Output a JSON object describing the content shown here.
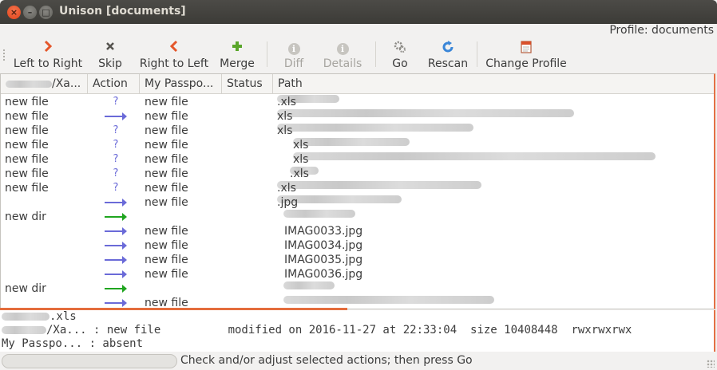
{
  "window": {
    "title": "Unison [documents]"
  },
  "profile_label": "Profile: documents",
  "toolbar": {
    "left_to_right": "Left to Right",
    "skip": "Skip",
    "right_to_left": "Right to Left",
    "merge": "Merge",
    "diff": "Diff",
    "details": "Details",
    "go": "Go",
    "rescan": "Rescan",
    "change_profile": "Change Profile"
  },
  "columns": {
    "left": "/Xa...",
    "action": "Action",
    "right": "My Passpo...",
    "status": "Status",
    "path": "Path"
  },
  "rows": [
    {
      "left": "new file",
      "action": "?",
      "right": "new file",
      "path": ".xls"
    },
    {
      "left": "new file",
      "action": "arrow-right",
      "right": "new file",
      "path": "xls"
    },
    {
      "left": "new file",
      "action": "?",
      "right": "new file",
      "path": "xls"
    },
    {
      "left": "new file",
      "action": "?",
      "right": "new file",
      "path": "xls"
    },
    {
      "left": "new file",
      "action": "?",
      "right": "new file",
      "path": "xls"
    },
    {
      "left": "new file",
      "action": "?",
      "right": "new file",
      "path": ".xls"
    },
    {
      "left": "new file",
      "action": "?",
      "right": "new file",
      "path": ".xls"
    },
    {
      "left": "",
      "action": "arrow-right",
      "right": "new file",
      "path": ".jpg"
    },
    {
      "left": "new dir",
      "action": "arrow-right-green",
      "right": "",
      "path": ""
    },
    {
      "left": "",
      "action": "arrow-right",
      "right": "new file",
      "path": "IMAG0033.jpg"
    },
    {
      "left": "",
      "action": "arrow-right",
      "right": "new file",
      "path": "IMAG0034.jpg"
    },
    {
      "left": "",
      "action": "arrow-right",
      "right": "new file",
      "path": "IMAG0035.jpg"
    },
    {
      "left": "",
      "action": "arrow-right",
      "right": "new file",
      "path": "IMAG0036.jpg"
    },
    {
      "left": "new dir",
      "action": "arrow-right-green",
      "right": "",
      "path": ""
    },
    {
      "left": "",
      "action": "arrow-right",
      "right": "new file",
      "path": ""
    }
  ],
  "details": {
    "line1": ".xls",
    "line2": "/Xa... : new file          modified on 2016-11-27 at 22:33:04  size 10408448  rwxrwxrwx",
    "line3": "My Passpo... : absent"
  },
  "status": {
    "text": "Check and/or adjust selected actions; then press Go"
  },
  "colors": {
    "accent": "#e46d3c",
    "arrow_blue": "#6a6ad8",
    "arrow_green": "#1fa51f",
    "titlebar": "#3c3b37"
  }
}
